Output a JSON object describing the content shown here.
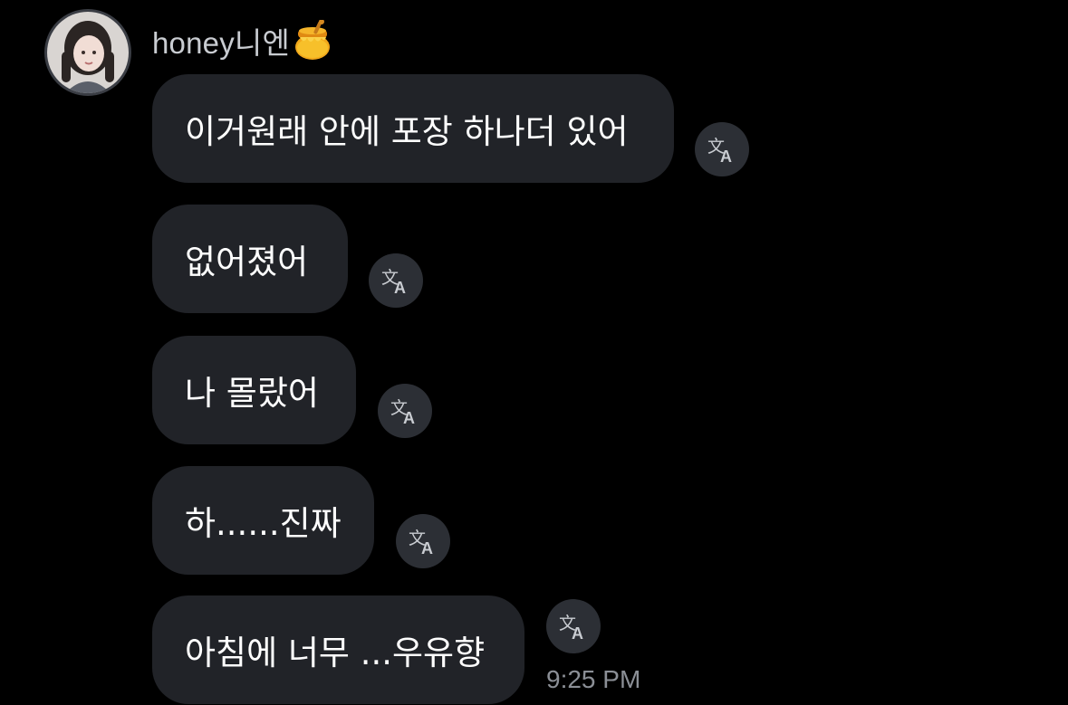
{
  "sender": {
    "name": "honey니엔",
    "badge_icon": "honey-pot-icon"
  },
  "messages": [
    {
      "text": "이거원래 안에 포장 하나더 있어",
      "translate_icon": "translate-icon"
    },
    {
      "text": "없어졌어",
      "translate_icon": "translate-icon"
    },
    {
      "text": "나 몰랐어",
      "translate_icon": "translate-icon"
    },
    {
      "text": "하......진짜",
      "translate_icon": "translate-icon"
    },
    {
      "text": "아침에 너무 ...우유향",
      "translate_icon": "translate-icon"
    }
  ],
  "timestamp": "9:25 PM",
  "colors": {
    "background": "#000000",
    "bubble": "#212328",
    "bubble_text": "#ffffff",
    "sender_name": "#c9ccd1",
    "translate_button": "#2c2f35",
    "timestamp": "#8b8f96"
  }
}
